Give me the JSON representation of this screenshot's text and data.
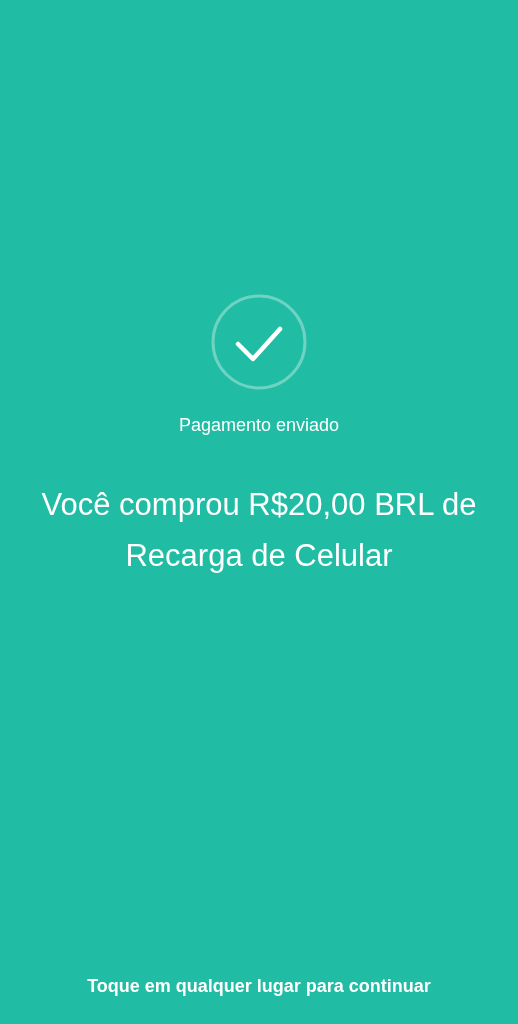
{
  "status": {
    "label": "Pagamento enviado"
  },
  "headline": "Você comprou R$20,00 BRL de Recarga de Celular",
  "footer": "Toque em qualquer lugar para continuar"
}
